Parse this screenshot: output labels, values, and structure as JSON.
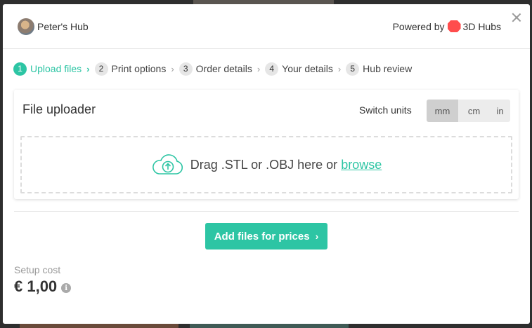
{
  "header": {
    "hub_name": "Peter's Hub",
    "powered_by": "Powered by",
    "brand": "3D Hubs",
    "brand_color": "#ff4d4d"
  },
  "steps": [
    {
      "number": "1",
      "label": "Upload files",
      "active": true
    },
    {
      "number": "2",
      "label": "Print options",
      "active": false
    },
    {
      "number": "3",
      "label": "Order details",
      "active": false
    },
    {
      "number": "4",
      "label": "Your details",
      "active": false
    },
    {
      "number": "5",
      "label": "Hub review",
      "active": false
    }
  ],
  "uploader": {
    "title": "File uploader",
    "units_label": "Switch units",
    "units": [
      "mm",
      "cm",
      "in"
    ],
    "selected_unit": "mm",
    "drop_text": "Drag .STL or .OBJ here or",
    "browse_label": "browse",
    "icon": "cloud-upload-icon"
  },
  "action": {
    "add_files_label": "Add files for prices"
  },
  "pricing": {
    "setup_label": "Setup cost",
    "setup_value": "€ 1,00"
  },
  "colors": {
    "accent": "#2dc5a4"
  }
}
